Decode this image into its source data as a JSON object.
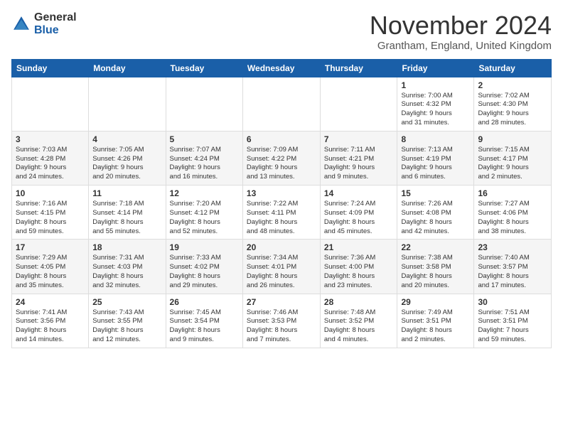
{
  "logo": {
    "general": "General",
    "blue": "Blue",
    "icon": "▶"
  },
  "header": {
    "month": "November 2024",
    "location": "Grantham, England, United Kingdom"
  },
  "weekdays": [
    "Sunday",
    "Monday",
    "Tuesday",
    "Wednesday",
    "Thursday",
    "Friday",
    "Saturday"
  ],
  "weeks": [
    [
      {
        "day": "",
        "info": ""
      },
      {
        "day": "",
        "info": ""
      },
      {
        "day": "",
        "info": ""
      },
      {
        "day": "",
        "info": ""
      },
      {
        "day": "",
        "info": ""
      },
      {
        "day": "1",
        "info": "Sunrise: 7:00 AM\nSunset: 4:32 PM\nDaylight: 9 hours\nand 31 minutes."
      },
      {
        "day": "2",
        "info": "Sunrise: 7:02 AM\nSunset: 4:30 PM\nDaylight: 9 hours\nand 28 minutes."
      }
    ],
    [
      {
        "day": "3",
        "info": "Sunrise: 7:03 AM\nSunset: 4:28 PM\nDaylight: 9 hours\nand 24 minutes."
      },
      {
        "day": "4",
        "info": "Sunrise: 7:05 AM\nSunset: 4:26 PM\nDaylight: 9 hours\nand 20 minutes."
      },
      {
        "day": "5",
        "info": "Sunrise: 7:07 AM\nSunset: 4:24 PM\nDaylight: 9 hours\nand 16 minutes."
      },
      {
        "day": "6",
        "info": "Sunrise: 7:09 AM\nSunset: 4:22 PM\nDaylight: 9 hours\nand 13 minutes."
      },
      {
        "day": "7",
        "info": "Sunrise: 7:11 AM\nSunset: 4:21 PM\nDaylight: 9 hours\nand 9 minutes."
      },
      {
        "day": "8",
        "info": "Sunrise: 7:13 AM\nSunset: 4:19 PM\nDaylight: 9 hours\nand 6 minutes."
      },
      {
        "day": "9",
        "info": "Sunrise: 7:15 AM\nSunset: 4:17 PM\nDaylight: 9 hours\nand 2 minutes."
      }
    ],
    [
      {
        "day": "10",
        "info": "Sunrise: 7:16 AM\nSunset: 4:15 PM\nDaylight: 8 hours\nand 59 minutes."
      },
      {
        "day": "11",
        "info": "Sunrise: 7:18 AM\nSunset: 4:14 PM\nDaylight: 8 hours\nand 55 minutes."
      },
      {
        "day": "12",
        "info": "Sunrise: 7:20 AM\nSunset: 4:12 PM\nDaylight: 8 hours\nand 52 minutes."
      },
      {
        "day": "13",
        "info": "Sunrise: 7:22 AM\nSunset: 4:11 PM\nDaylight: 8 hours\nand 48 minutes."
      },
      {
        "day": "14",
        "info": "Sunrise: 7:24 AM\nSunset: 4:09 PM\nDaylight: 8 hours\nand 45 minutes."
      },
      {
        "day": "15",
        "info": "Sunrise: 7:26 AM\nSunset: 4:08 PM\nDaylight: 8 hours\nand 42 minutes."
      },
      {
        "day": "16",
        "info": "Sunrise: 7:27 AM\nSunset: 4:06 PM\nDaylight: 8 hours\nand 38 minutes."
      }
    ],
    [
      {
        "day": "17",
        "info": "Sunrise: 7:29 AM\nSunset: 4:05 PM\nDaylight: 8 hours\nand 35 minutes."
      },
      {
        "day": "18",
        "info": "Sunrise: 7:31 AM\nSunset: 4:03 PM\nDaylight: 8 hours\nand 32 minutes."
      },
      {
        "day": "19",
        "info": "Sunrise: 7:33 AM\nSunset: 4:02 PM\nDaylight: 8 hours\nand 29 minutes."
      },
      {
        "day": "20",
        "info": "Sunrise: 7:34 AM\nSunset: 4:01 PM\nDaylight: 8 hours\nand 26 minutes."
      },
      {
        "day": "21",
        "info": "Sunrise: 7:36 AM\nSunset: 4:00 PM\nDaylight: 8 hours\nand 23 minutes."
      },
      {
        "day": "22",
        "info": "Sunrise: 7:38 AM\nSunset: 3:58 PM\nDaylight: 8 hours\nand 20 minutes."
      },
      {
        "day": "23",
        "info": "Sunrise: 7:40 AM\nSunset: 3:57 PM\nDaylight: 8 hours\nand 17 minutes."
      }
    ],
    [
      {
        "day": "24",
        "info": "Sunrise: 7:41 AM\nSunset: 3:56 PM\nDaylight: 8 hours\nand 14 minutes."
      },
      {
        "day": "25",
        "info": "Sunrise: 7:43 AM\nSunset: 3:55 PM\nDaylight: 8 hours\nand 12 minutes."
      },
      {
        "day": "26",
        "info": "Sunrise: 7:45 AM\nSunset: 3:54 PM\nDaylight: 8 hours\nand 9 minutes."
      },
      {
        "day": "27",
        "info": "Sunrise: 7:46 AM\nSunset: 3:53 PM\nDaylight: 8 hours\nand 7 minutes."
      },
      {
        "day": "28",
        "info": "Sunrise: 7:48 AM\nSunset: 3:52 PM\nDaylight: 8 hours\nand 4 minutes."
      },
      {
        "day": "29",
        "info": "Sunrise: 7:49 AM\nSunset: 3:51 PM\nDaylight: 8 hours\nand 2 minutes."
      },
      {
        "day": "30",
        "info": "Sunrise: 7:51 AM\nSunset: 3:51 PM\nDaylight: 7 hours\nand 59 minutes."
      }
    ]
  ]
}
